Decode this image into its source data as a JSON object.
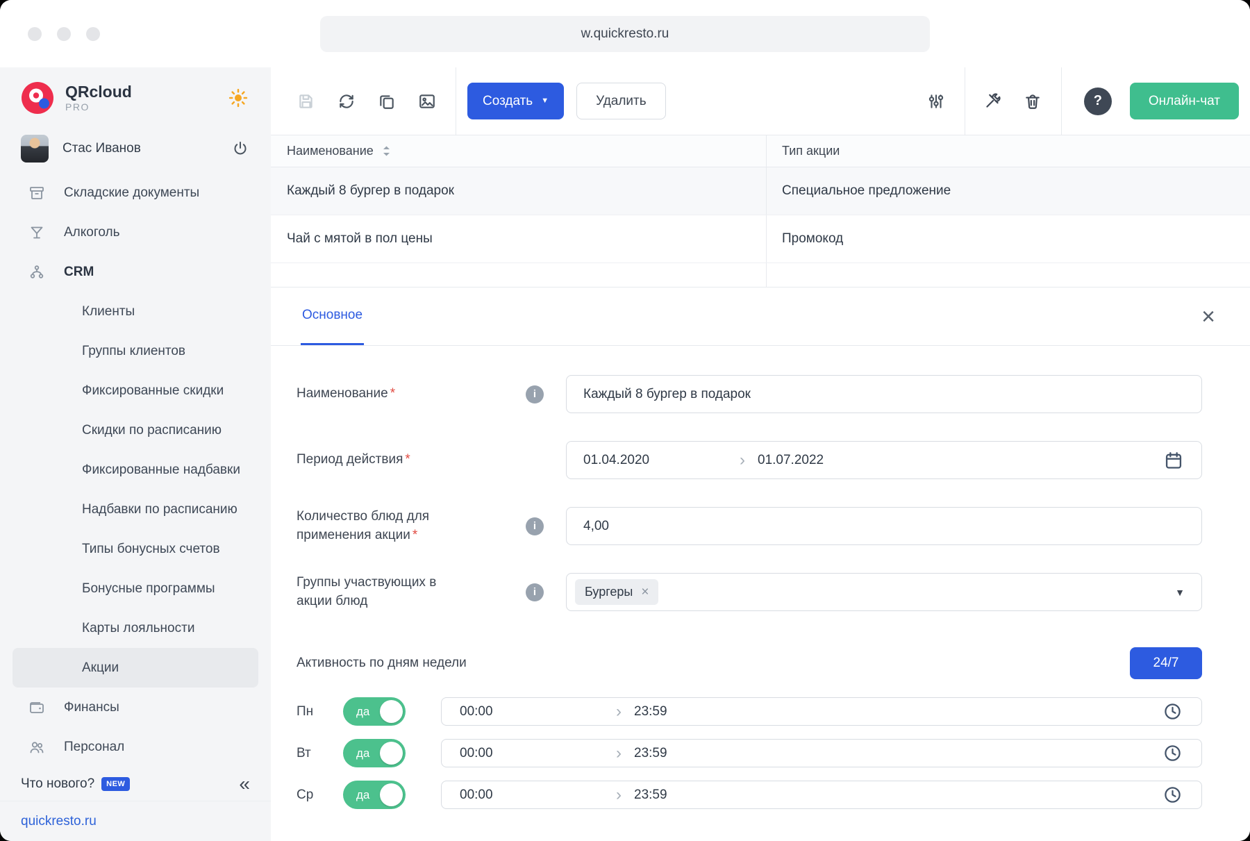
{
  "window": {
    "url": "w.quickresto.ru"
  },
  "glyphs": {
    "caret_down": "▼",
    "chevron_right": "›",
    "close": "×",
    "collapse": "«",
    "remove": "×",
    "required": "*",
    "info": "i",
    "help": "?"
  },
  "sidebar": {
    "logo_title": "QRcloud",
    "logo_subtitle": "PRO",
    "user": {
      "name": "Стас Иванов"
    },
    "items": [
      {
        "label": "Складские документы"
      },
      {
        "label": "Алкоголь"
      },
      {
        "label": "CRM"
      },
      {
        "label": "Клиенты"
      },
      {
        "label": "Группы клиентов"
      },
      {
        "label": "Фиксированные скидки"
      },
      {
        "label": "Скидки по расписанию"
      },
      {
        "label": "Фиксированные надбавки"
      },
      {
        "label": "Надбавки по расписанию"
      },
      {
        "label": "Типы бонусных счетов"
      },
      {
        "label": "Бонусные программы"
      },
      {
        "label": "Карты лояльности"
      },
      {
        "label": "Акции"
      },
      {
        "label": "Финансы"
      },
      {
        "label": "Персонал"
      }
    ],
    "whats_new": "Что нового?",
    "new_badge": "NEW",
    "site_link": "quickresto.ru"
  },
  "toolbar": {
    "create_label": "Создать",
    "delete_label": "Удалить",
    "chat_label": "Онлайн-чат"
  },
  "table": {
    "columns": [
      "Наименование",
      "Тип акции"
    ],
    "rows": [
      {
        "name": "Каждый 8 бургер в подарок",
        "type": "Специальное предложение"
      },
      {
        "name": "Чай с мятой в пол цены",
        "type": "Промокод"
      }
    ]
  },
  "panel": {
    "tab": "Основное",
    "fields": {
      "name": {
        "label": "Наименование",
        "value": "Каждый 8 бургер в подарок"
      },
      "period": {
        "label": "Период действия",
        "from": "01.04.2020",
        "to": "01.07.2022"
      },
      "quantity": {
        "label": "Количество блюд для применения акции",
        "value": "4,00"
      },
      "groups": {
        "label": "Группы участвующих в акции блюд",
        "tag": "Бургеры"
      },
      "activity": {
        "label": "Активность по дням недели",
        "badge": "24/7"
      }
    },
    "days": [
      {
        "day": "Пн",
        "toggle": "да",
        "from": "00:00",
        "to": "23:59"
      },
      {
        "day": "Вт",
        "toggle": "да",
        "from": "00:00",
        "to": "23:59"
      },
      {
        "day": "Ср",
        "toggle": "да",
        "from": "00:00",
        "to": "23:59"
      }
    ]
  },
  "colors": {
    "accent_blue": "#2d5be0",
    "chat_green": "#3fbe8e",
    "toggle_green": "#4cc18d",
    "logo_red": "#ee2d4d",
    "sun_orange": "#f6a723",
    "required_red": "#e14b42"
  }
}
